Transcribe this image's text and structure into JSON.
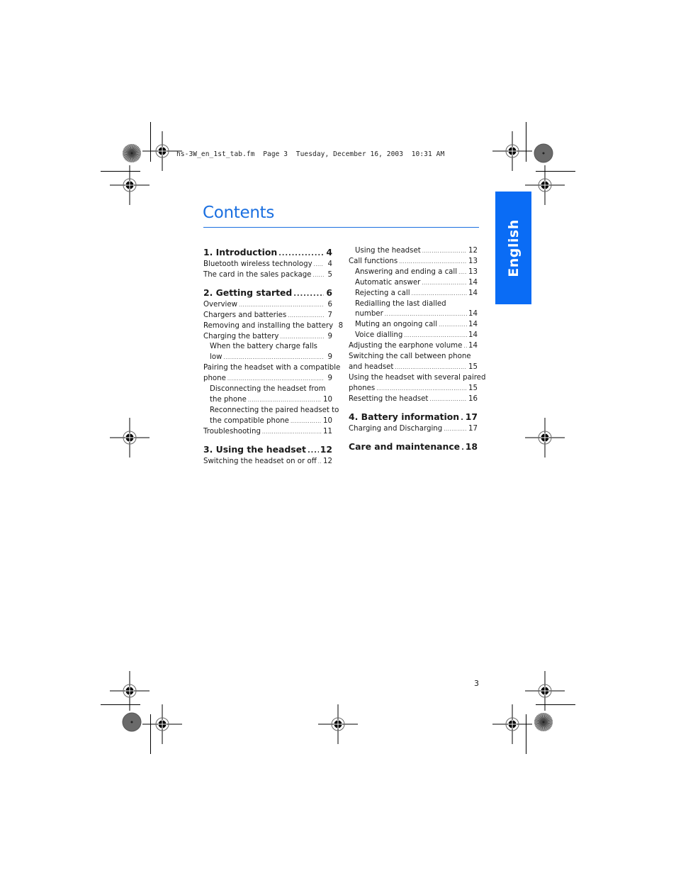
{
  "header": {
    "file_info": "hs-3W_en_1st_tab.fm  Page 3  Tuesday, December 16, 2003  10:31 AM"
  },
  "title": "Contents",
  "language_tab": "English",
  "page_number": "3",
  "toc": {
    "left": [
      {
        "type": "chapter",
        "label": "1. Introduction",
        "page": "4"
      },
      {
        "type": "section",
        "label": "Bluetooth wireless technology",
        "page": "4"
      },
      {
        "type": "section",
        "label": "The card in the sales package",
        "page": "5"
      },
      {
        "type": "chapter",
        "label": "2. Getting started",
        "page": "6"
      },
      {
        "type": "section",
        "label": "Overview",
        "page": "6"
      },
      {
        "type": "section",
        "label": "Chargers and batteries",
        "page": "7"
      },
      {
        "type": "section",
        "label": "Removing and installing the battery",
        "page": "8"
      },
      {
        "type": "section",
        "label": "Charging the battery",
        "page": "9"
      },
      {
        "type": "subsection",
        "label_line1": "When the battery charge falls",
        "label": "low",
        "page": "9"
      },
      {
        "type": "section",
        "label_line1": "Pairing the headset with a compatible",
        "label": "phone",
        "page": "9"
      },
      {
        "type": "subsection",
        "label_line1": "Disconnecting the headset from",
        "label": "the phone",
        "page": "10"
      },
      {
        "type": "subsection",
        "label_line1": "Reconnecting the paired headset to",
        "label": "the compatible phone",
        "page": "10"
      },
      {
        "type": "section",
        "label": "Troubleshooting",
        "page": "11"
      },
      {
        "type": "chapter",
        "label": "3. Using the headset",
        "page": "12"
      },
      {
        "type": "section",
        "label": "Switching the headset on or off",
        "page": "12"
      }
    ],
    "right": [
      {
        "type": "subsection",
        "label": "Using the headset",
        "page": "12"
      },
      {
        "type": "section",
        "label": "Call functions",
        "page": "13"
      },
      {
        "type": "subsection",
        "label": "Answering and ending a call",
        "page": "13"
      },
      {
        "type": "subsection",
        "label": "Automatic answer",
        "page": "14"
      },
      {
        "type": "subsection",
        "label": "Rejecting a call",
        "page": "14"
      },
      {
        "type": "subsection",
        "label_line1": "Redialling the last dialled",
        "label": "number",
        "page": "14"
      },
      {
        "type": "subsection",
        "label": "Muting an ongoing call",
        "page": "14"
      },
      {
        "type": "subsection",
        "label": "Voice dialling",
        "page": "14"
      },
      {
        "type": "section",
        "label": "Adjusting the earphone volume",
        "page": "14"
      },
      {
        "type": "section",
        "label_line1": "Switching the call between phone",
        "label": "and headset",
        "page": "15"
      },
      {
        "type": "section",
        "label_line1": "Using the headset with several paired",
        "label": "phones",
        "page": "15"
      },
      {
        "type": "section",
        "label": "Resetting the headset",
        "page": "16"
      },
      {
        "type": "chapter",
        "label": "4. Battery information",
        "page": "17"
      },
      {
        "type": "section",
        "label": "Charging and Discharging",
        "page": "17"
      },
      {
        "type": "chapter",
        "label": "Care and maintenance",
        "page": "18"
      }
    ]
  },
  "colors": {
    "accent_blue": "#1a6fe0",
    "tab_blue": "#0a6cf5"
  }
}
